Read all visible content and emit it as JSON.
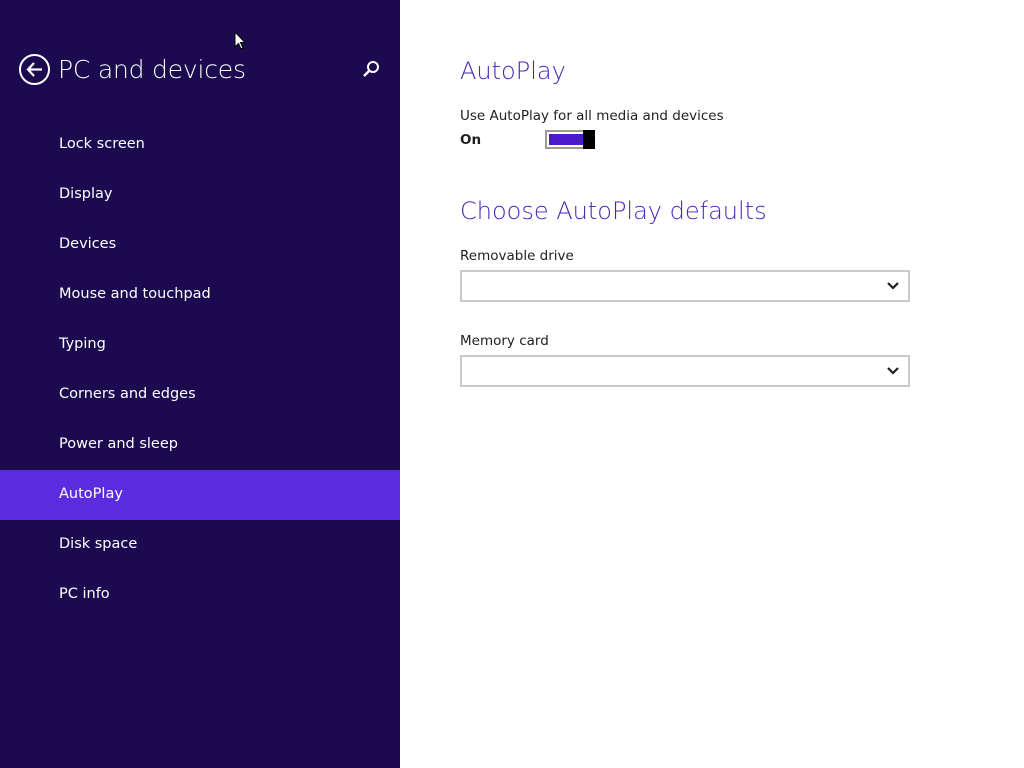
{
  "sidebar": {
    "title": "PC and devices",
    "back_icon": "back-arrow-icon",
    "search_icon": "search-icon",
    "items": [
      {
        "label": "Lock screen",
        "selected": false
      },
      {
        "label": "Display",
        "selected": false
      },
      {
        "label": "Devices",
        "selected": false
      },
      {
        "label": "Mouse and touchpad",
        "selected": false
      },
      {
        "label": "Typing",
        "selected": false
      },
      {
        "label": "Corners and edges",
        "selected": false
      },
      {
        "label": "Power and sleep",
        "selected": false
      },
      {
        "label": "AutoPlay",
        "selected": true
      },
      {
        "label": "Disk space",
        "selected": false
      },
      {
        "label": "PC info",
        "selected": false
      }
    ]
  },
  "content": {
    "autoplay_heading": "AutoPlay",
    "use_autoplay_label": "Use AutoPlay for all media and devices",
    "use_autoplay_state": "On",
    "use_autoplay_on": true,
    "defaults_heading": "Choose AutoPlay defaults",
    "removable_drive_label": "Removable drive",
    "removable_drive_value": "",
    "memory_card_label": "Memory card",
    "memory_card_value": ""
  },
  "colors": {
    "sidebar_bg": "#1b0a4f",
    "selected_item_bg": "#5b2be0",
    "accent": "#4b25b8",
    "toggle_fill": "#4a19c9"
  }
}
